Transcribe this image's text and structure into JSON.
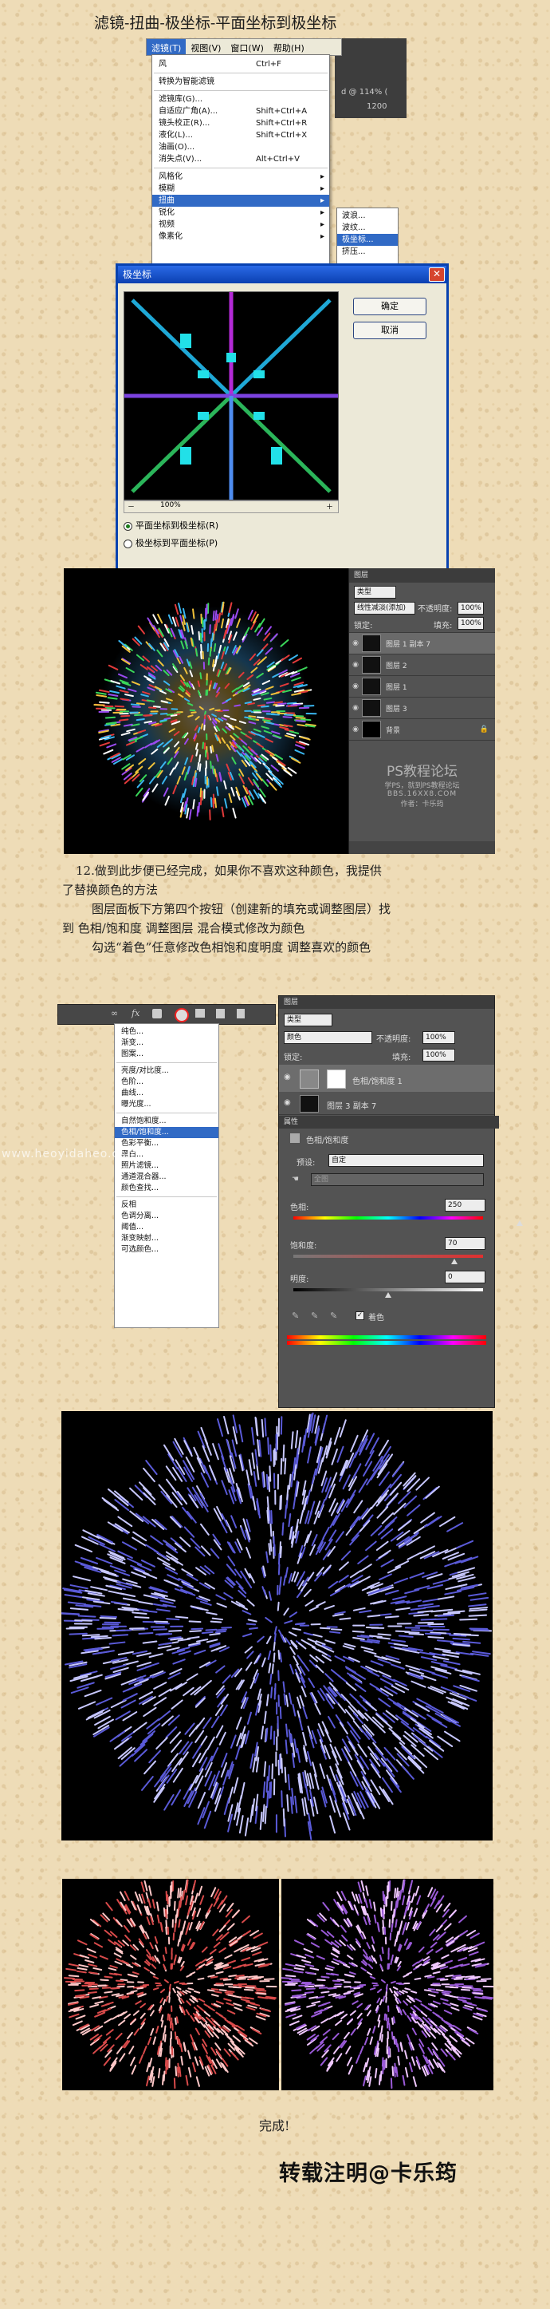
{
  "header": {
    "title": "滤镜-扭曲-极坐标-平面坐标到极坐标"
  },
  "filter_menu": {
    "menubar": [
      "滤镜(T)",
      "视图(V)",
      "窗口(W)",
      "帮助(H)"
    ],
    "ps_info": "d @ 114% (",
    "ruler": "1200",
    "items": [
      {
        "label": "风",
        "shortcut": "Ctrl+F"
      },
      {
        "label": "转换为智能滤镜",
        "shortcut": ""
      },
      {
        "label": "滤镜库(G)...",
        "shortcut": ""
      },
      {
        "label": "自适应广角(A)...",
        "shortcut": "Shift+Ctrl+A"
      },
      {
        "label": "镜头校正(R)...",
        "shortcut": "Shift+Ctrl+R"
      },
      {
        "label": "液化(L)...",
        "shortcut": "Shift+Ctrl+X"
      },
      {
        "label": "油画(O)...",
        "shortcut": ""
      },
      {
        "label": "消失点(V)...",
        "shortcut": "Alt+Ctrl+V"
      },
      {
        "label": "风格化",
        "shortcut": ""
      },
      {
        "label": "模糊",
        "shortcut": ""
      },
      {
        "label": "扭曲",
        "shortcut": ""
      },
      {
        "label": "锐化",
        "shortcut": ""
      },
      {
        "label": "视频",
        "shortcut": ""
      },
      {
        "label": "像素化",
        "shortcut": ""
      }
    ],
    "submenu": [
      "波浪...",
      "波纹...",
      "极坐标...",
      "挤压..."
    ]
  },
  "dialog": {
    "title": "极坐标",
    "ok_label": "确定",
    "cancel_label": "取消",
    "zoom": "100%",
    "option_rect_to_polar": "平面坐标到极坐标(R)",
    "option_polar_to_rect": "极坐标到平面坐标(P)"
  },
  "layers_panel": {
    "title": "图层",
    "filter_kind": "类型",
    "blend_mode": "线性减淡(添加)",
    "opacity_label": "不透明度:",
    "opacity": "100%",
    "lock_label": "锁定:",
    "fill_label": "填充:",
    "fill": "100%",
    "layers": [
      "图层 1 副本 7",
      "图层 2",
      "图层 1",
      "图层 3",
      "背景"
    ]
  },
  "watermark": {
    "line1": "PS教程论坛",
    "line2": "学PS，就到PS教程论坛",
    "line3": "BBS.16XX8.COM",
    "line4": "作者：卡乐筠"
  },
  "paragraphs": {
    "p1": "12.做到此步便已经完成，如果你不喜欢这种颜色，我提供",
    "p1b": "了替换颜色的方法",
    "p2": "图层面板下方第四个按钮（创建新的填充或调整图层）找",
    "p2b": "到 色相/饱和度 调整图层 混合模式修改为颜色",
    "p3": "勾选“着色”任意修改色相饱和度明度 调整喜欢的颜色"
  },
  "adjust_menu": [
    "纯色...",
    "渐变...",
    "图案...",
    "亮度/对比度...",
    "色阶...",
    "曲线...",
    "曝光度...",
    "自然饱和度...",
    "色相/饱和度...",
    "色彩平衡...",
    "黑白...",
    "照片滤镜...",
    "通道混合器...",
    "颜色查找...",
    "反相",
    "色调分离...",
    "阈值...",
    "渐变映射...",
    "可选颜色..."
  ],
  "site_watermark": "www.heoyidaheo.com",
  "panel2": {
    "title": "图层",
    "kind": "类型",
    "blend": "颜色",
    "opacity_label": "不透明度:",
    "opacity": "100%",
    "lock_label": "锁定:",
    "fill_label": "填充:",
    "fill": "100%",
    "layer1": "色相/饱和度 1",
    "layer2": "图层 3 副本 7",
    "props_title": "属性",
    "props_sub": "色相/饱和度",
    "preset_label": "预设:",
    "preset_value": "自定",
    "channel_value": "全图",
    "hue_label": "色相:",
    "hue": "250",
    "sat_label": "饱和度:",
    "sat": "70",
    "light_label": "明度:",
    "light": "0",
    "colorize_label": "着色"
  },
  "footer": {
    "done": "完成!",
    "signature": "转载注明@卡乐筠"
  }
}
